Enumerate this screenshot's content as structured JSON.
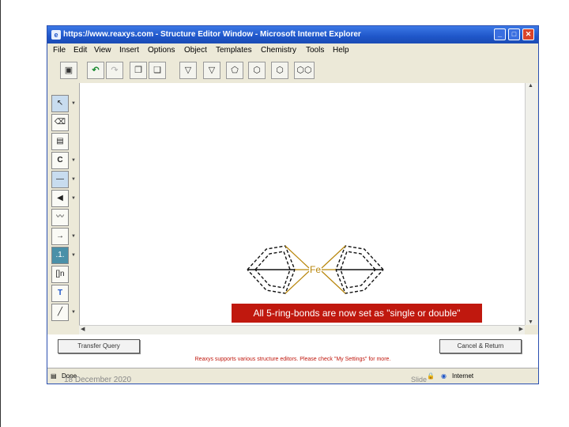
{
  "window": {
    "title": "https://www.reaxys.com - Structure Editor Window - Microsoft Internet Explorer",
    "min": "_",
    "max": "□",
    "close": "✕"
  },
  "menu": [
    "File",
    "Edit",
    "View",
    "Insert",
    "Options",
    "Object",
    "Templates",
    "Chemistry",
    "Tools",
    "Help"
  ],
  "left_tools": {
    "atom_c": "C",
    "chain": ".1.",
    "text_tool": "T",
    "bracket": "[]n"
  },
  "structure": {
    "metal_label": "Fe"
  },
  "callout": "All 5-ring-bonds are now set as \"single or double\"",
  "buttons": {
    "transfer": "Transfer Query",
    "cancel": "Cancel & Return"
  },
  "notice": "Reaxys supports various structure editors. Please check \"My Settings\" for more.",
  "status": {
    "left": "Done",
    "zone": "Internet"
  },
  "slide": {
    "date": "18 December 2020",
    "number": "Slide"
  },
  "colors": {
    "callout_bg": "#c0180e",
    "title_bar": "#1f56c9",
    "bond_color": "#b8860b"
  }
}
